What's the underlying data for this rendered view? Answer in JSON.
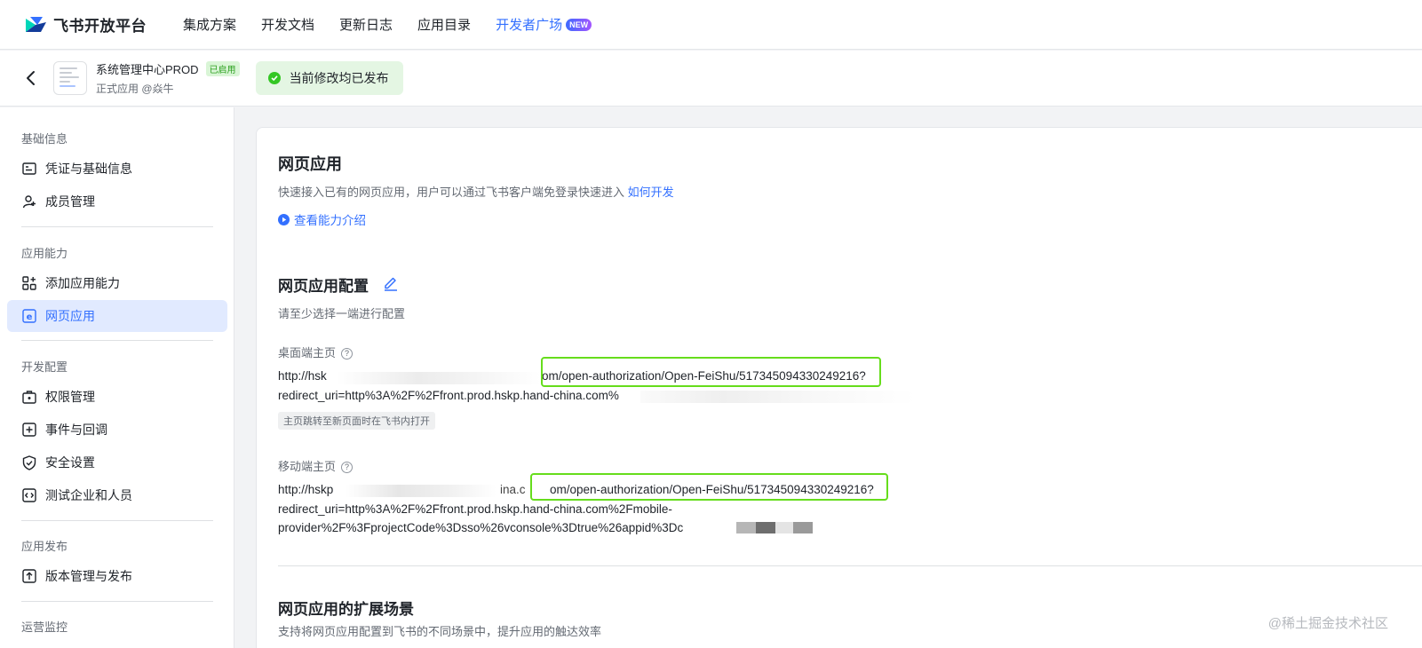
{
  "brand": {
    "name": "飞书开放平台"
  },
  "topnav": {
    "items": [
      "集成方案",
      "开发文档",
      "更新日志",
      "应用目录"
    ],
    "accent_item": "开发者广场",
    "accent_badge": "NEW"
  },
  "appbar": {
    "app_name": "系统管理中心PROD",
    "status_tag": "已启用",
    "app_sub": "正式应用 @焱牛",
    "toast": "当前修改均已发布"
  },
  "sidebar": {
    "groups": [
      "基础信息",
      "应用能力",
      "开发配置",
      "应用发布",
      "运营监控"
    ],
    "items": [
      {
        "label": "凭证与基础信息",
        "icon": "credential-icon"
      },
      {
        "label": "成员管理",
        "icon": "member-icon"
      },
      {
        "label": "添加应用能力",
        "icon": "add-capability-icon"
      },
      {
        "label": "网页应用",
        "icon": "web-app-icon",
        "active": true
      },
      {
        "label": "权限管理",
        "icon": "permission-icon"
      },
      {
        "label": "事件与回调",
        "icon": "event-icon"
      },
      {
        "label": "安全设置",
        "icon": "shield-icon"
      },
      {
        "label": "测试企业和人员",
        "icon": "test-icon"
      },
      {
        "label": "版本管理与发布",
        "icon": "upload-icon"
      }
    ]
  },
  "main": {
    "title": "网页应用",
    "desc": "快速接入已有的网页应用，用户可以通过飞书客户端免登录快速进入",
    "desc_link": "如何开发",
    "intro_link": "查看能力介绍",
    "config_title": "网页应用配置",
    "config_hint": "请至少选择一端进行配置",
    "desktop": {
      "label": "桌面端主页",
      "url_prefix": "http://hsk",
      "url_mid": "om/open-authorization/Open-FeiShu/517345094330249216?",
      "url_line2": "redirect_uri=http%3A%2F%2Ffront.prod.hskp.hand-china.com%",
      "chip": "主页跳转至新页面时在飞书内打开"
    },
    "mobile": {
      "label": "移动端主页",
      "url_prefix": "http://hskp",
      "url_mid_pre": "ina.c",
      "url_mid": "om/open-authorization/Open-FeiShu/517345094330249216?",
      "url_line2": "redirect_uri=http%3A%2F%2Ffront.prod.hskp.hand-china.com%2Fmobile-",
      "url_line3": "provider%2F%3FprojectCode%3Dsso%26vconsole%3Dtrue%26appid%3Dc"
    },
    "ext_title": "网页应用的扩展场景",
    "ext_desc": "支持将网页应用配置到飞书的不同场景中，提升应用的触达效率"
  },
  "watermark": "@稀土掘金技术社区",
  "colors": {
    "accent": "#3370ff",
    "highlight": "#66dd1c",
    "success": "#34c724"
  }
}
